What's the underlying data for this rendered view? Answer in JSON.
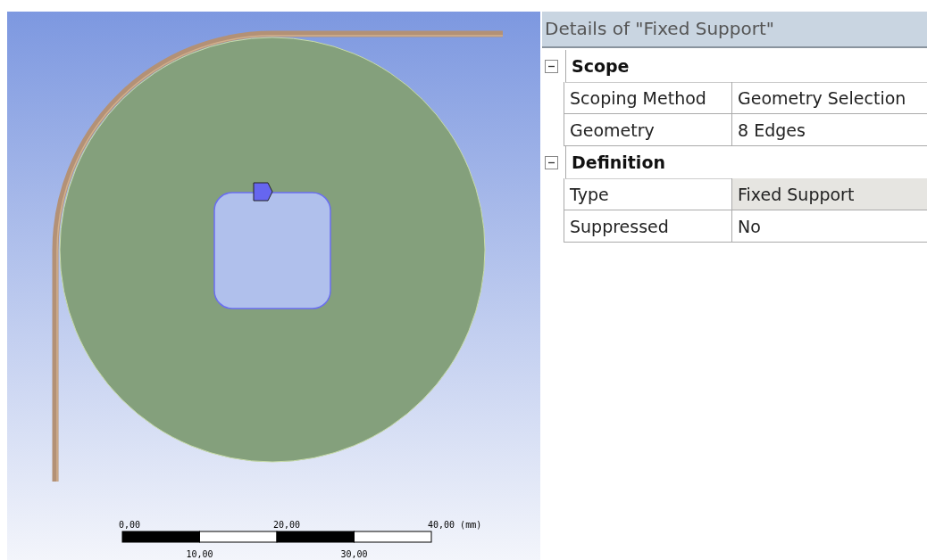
{
  "viewport": {
    "scale_bar": {
      "top_labels": [
        "0,00",
        "20,00",
        "40,00 (mm)"
      ],
      "bottom_labels": [
        "10,00",
        "30,00"
      ]
    }
  },
  "details": {
    "title": "Details of \"Fixed Support\"",
    "groups": [
      {
        "label": "Scope",
        "expanded": true,
        "rows": [
          {
            "name": "Scoping Method",
            "value": "Geometry Selection",
            "highlighted": false
          },
          {
            "name": "Geometry",
            "value": "8 Edges",
            "highlighted": false
          }
        ]
      },
      {
        "label": "Definition",
        "expanded": true,
        "rows": [
          {
            "name": "Type",
            "value": "Fixed Support",
            "highlighted": true
          },
          {
            "name": "Suppressed",
            "value": "No",
            "highlighted": false
          }
        ]
      }
    ]
  }
}
